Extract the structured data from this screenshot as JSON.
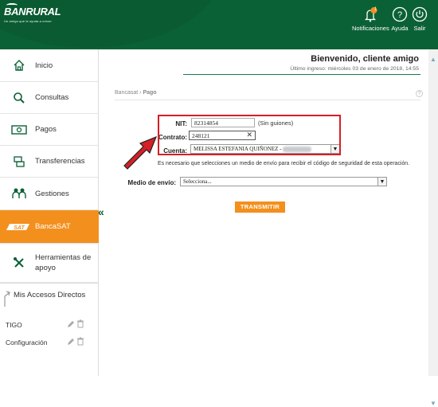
{
  "header": {
    "brand": "BANRURAL",
    "tagline": "Un amigo que te ayuda a crecer",
    "notifications_label": "Notificaciones",
    "notifications_count": "1",
    "help_label": "Ayuda",
    "exit_label": "Salir"
  },
  "sidebar": {
    "items": [
      {
        "label": "Inicio",
        "icon": "home-icon"
      },
      {
        "label": "Consultas",
        "icon": "search-icon"
      },
      {
        "label": "Pagos",
        "icon": "money-icon"
      },
      {
        "label": "Transferencias",
        "icon": "transfer-icon"
      },
      {
        "label": "Gestiones",
        "icon": "people-icon"
      },
      {
        "label": "BancaSAT",
        "icon": "sat-logo-icon"
      },
      {
        "label": "Herramientas de apoyo",
        "icon": "tools-icon"
      }
    ],
    "accesos_title": "Mis Accesos Directos",
    "accesos": [
      "TIGO",
      "Configuración"
    ]
  },
  "welcome": {
    "title": "Bienvenido, cliente amigo",
    "last_login": "Último ingreso: miércoles 03 de enero de 2018, 14:55"
  },
  "breadcrumb": {
    "parent": "Bancasat",
    "sep": "›",
    "current": "Pago"
  },
  "form": {
    "nit_label": "NIT:",
    "nit_value": "82314854",
    "nit_hint": "(Sin guiones)",
    "contrato_label": "Contrato:",
    "contrato_value": "248121",
    "cuenta_label": "Cuenta:",
    "cuenta_value": "MELISSA ESTEFANIA QUIÑONEZ -",
    "info_text": "Es necesario que selecciones un medio de envío para recibir el código de seguridad de esta operación.",
    "medio_label": "Medio de envío:",
    "medio_value": "Selecciona...",
    "submit_label": "TRANSMITIR"
  },
  "colors": {
    "brand_green": "#0b6136",
    "accent_orange": "#f38f1d",
    "highlight_red": "#d61f26"
  }
}
